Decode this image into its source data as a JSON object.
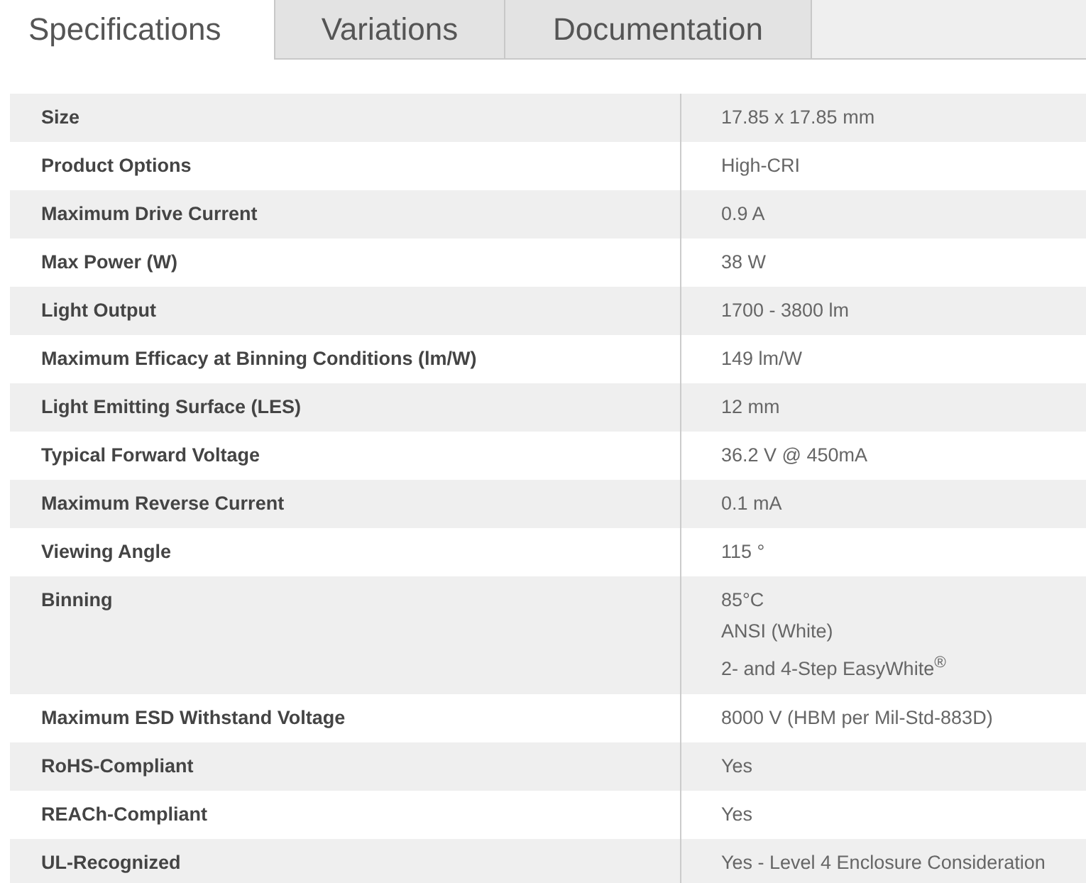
{
  "tabs": [
    {
      "label": "Specifications",
      "selected": true
    },
    {
      "label": "Variations",
      "selected": false
    },
    {
      "label": "Documentation",
      "selected": false
    }
  ],
  "table": {
    "rows": [
      {
        "label": "Size",
        "values": [
          "17.85 x 17.85 mm"
        ]
      },
      {
        "label": "Product Options",
        "values": [
          "High-CRI"
        ]
      },
      {
        "label": "Maximum Drive Current",
        "values": [
          "0.9 A"
        ]
      },
      {
        "label": "Max Power (W)",
        "values": [
          "38 W"
        ]
      },
      {
        "label": "Light Output",
        "values": [
          "1700 - 3800 lm"
        ]
      },
      {
        "label": "Maximum Efficacy at Binning Conditions (lm/W)",
        "values": [
          "149 lm/W"
        ]
      },
      {
        "label": "Light Emitting Surface (LES)",
        "values": [
          "12 mm"
        ]
      },
      {
        "label": "Typical Forward Voltage",
        "values": [
          "36.2 V @ 450mA"
        ]
      },
      {
        "label": "Maximum Reverse Current",
        "values": [
          "0.1 mA"
        ]
      },
      {
        "label": "Viewing Angle",
        "values": [
          "115 °"
        ]
      },
      {
        "label": "Binning",
        "values": [
          "85°C",
          "ANSI (White)",
          "2- and 4-Step EasyWhite$^{®}$"
        ]
      },
      {
        "label": "Maximum ESD Withstand Voltage",
        "values": [
          "8000 V (HBM per Mil-Std-883D)"
        ]
      },
      {
        "label": "RoHS-Compliant",
        "values": [
          "Yes"
        ]
      },
      {
        "label": "REACh-Compliant",
        "values": [
          "Yes"
        ]
      },
      {
        "label": "UL-Recognized",
        "values": [
          "Yes - Level 4 Enclosure Consideration"
        ]
      }
    ]
  }
}
